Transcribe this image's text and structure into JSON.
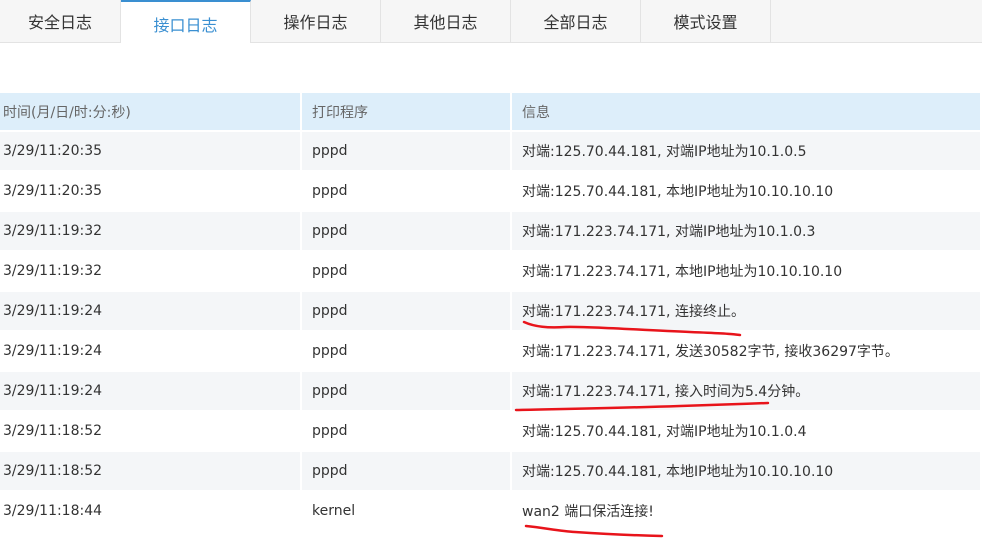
{
  "tabs": [
    {
      "label": "安全日志",
      "active": false
    },
    {
      "label": "接口日志",
      "active": true
    },
    {
      "label": "操作日志",
      "active": false
    },
    {
      "label": "其他日志",
      "active": false
    },
    {
      "label": "全部日志",
      "active": false
    },
    {
      "label": "模式设置",
      "active": false
    }
  ],
  "table": {
    "headers": [
      "时间(月/日/时:分:秒)",
      "打印程序",
      "信息"
    ],
    "rows": [
      [
        "3/29/11:20:35",
        "pppd",
        "对端:125.70.44.181, 对端IP地址为10.1.0.5"
      ],
      [
        "3/29/11:20:35",
        "pppd",
        "对端:125.70.44.181, 本地IP地址为10.10.10.10"
      ],
      [
        "3/29/11:19:32",
        "pppd",
        "对端:171.223.74.171, 对端IP地址为10.1.0.3"
      ],
      [
        "3/29/11:19:32",
        "pppd",
        "对端:171.223.74.171, 本地IP地址为10.10.10.10"
      ],
      [
        "3/29/11:19:24",
        "pppd",
        "对端:171.223.74.171, 连接终止。"
      ],
      [
        "3/29/11:19:24",
        "pppd",
        "对端:171.223.74.171, 发送30582字节, 接收36297字节。"
      ],
      [
        "3/29/11:19:24",
        "pppd",
        "对端:171.223.74.171, 接入时间为5.4分钟。"
      ],
      [
        "3/29/11:18:52",
        "pppd",
        "对端:125.70.44.181, 对端IP地址为10.1.0.4"
      ],
      [
        "3/29/11:18:52",
        "pppd",
        "对端:125.70.44.181, 本地IP地址为10.10.10.10"
      ],
      [
        "3/29/11:18:44",
        "kernel",
        "wan2 端口保活连接!"
      ]
    ]
  },
  "colors": {
    "accent": "#3a8fd1",
    "header_bg": "#ddeefa",
    "stripe_bg": "#f4f6f8",
    "annotation": "#e8141b"
  }
}
